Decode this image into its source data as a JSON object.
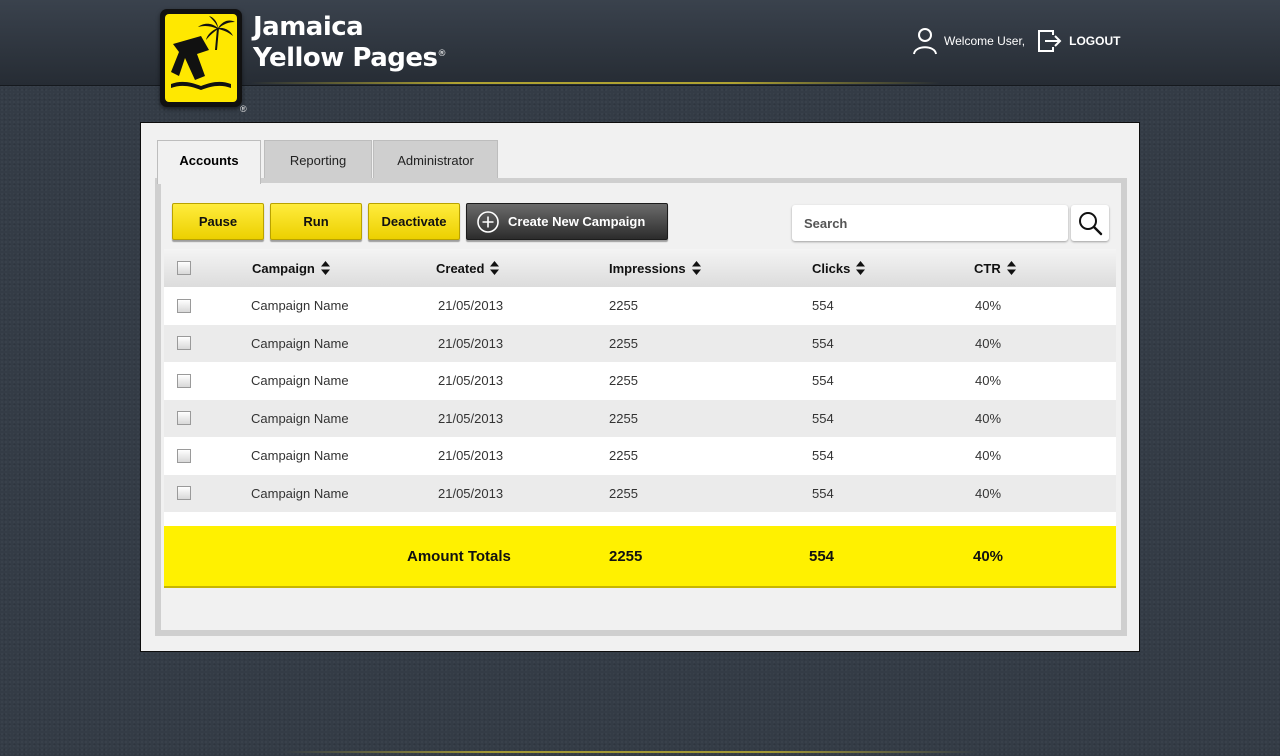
{
  "brand": {
    "line1": "Jamaica",
    "line2": "Yellow Pages",
    "reg": "®"
  },
  "user": {
    "welcome": "Welcome User,",
    "logout": "LOGOUT"
  },
  "tabs": [
    {
      "label": "Accounts",
      "active": true
    },
    {
      "label": "Reporting",
      "active": false
    },
    {
      "label": "Administrator",
      "active": false
    }
  ],
  "toolbar": {
    "pause": "Pause",
    "run": "Run",
    "deactivate": "Deactivate",
    "create": "Create New Campaign"
  },
  "search": {
    "placeholder": "Search"
  },
  "table": {
    "columns": [
      "Campaign",
      "Created",
      "Impressions",
      "Clicks",
      "CTR"
    ],
    "rows": [
      {
        "campaign": "Campaign Name",
        "created": "21/05/2013",
        "impressions": "2255",
        "clicks": "554",
        "ctr": "40%"
      },
      {
        "campaign": "Campaign Name",
        "created": "21/05/2013",
        "impressions": "2255",
        "clicks": "554",
        "ctr": "40%"
      },
      {
        "campaign": "Campaign Name",
        "created": "21/05/2013",
        "impressions": "2255",
        "clicks": "554",
        "ctr": "40%"
      },
      {
        "campaign": "Campaign Name",
        "created": "21/05/2013",
        "impressions": "2255",
        "clicks": "554",
        "ctr": "40%"
      },
      {
        "campaign": "Campaign Name",
        "created": "21/05/2013",
        "impressions": "2255",
        "clicks": "554",
        "ctr": "40%"
      },
      {
        "campaign": "Campaign Name",
        "created": "21/05/2013",
        "impressions": "2255",
        "clicks": "554",
        "ctr": "40%"
      }
    ]
  },
  "totals": {
    "label": "Amount Totals",
    "impressions": "2255",
    "clicks": "554",
    "ctr": "40%"
  },
  "colors": {
    "accent": "#fff100",
    "button_yellow": "#f5dc10",
    "background": "#343c46"
  },
  "icons": {
    "user": "user-icon",
    "logout": "logout-icon",
    "add": "plus-circle-icon",
    "search": "search-icon",
    "sort": "sort-arrows-icon"
  }
}
